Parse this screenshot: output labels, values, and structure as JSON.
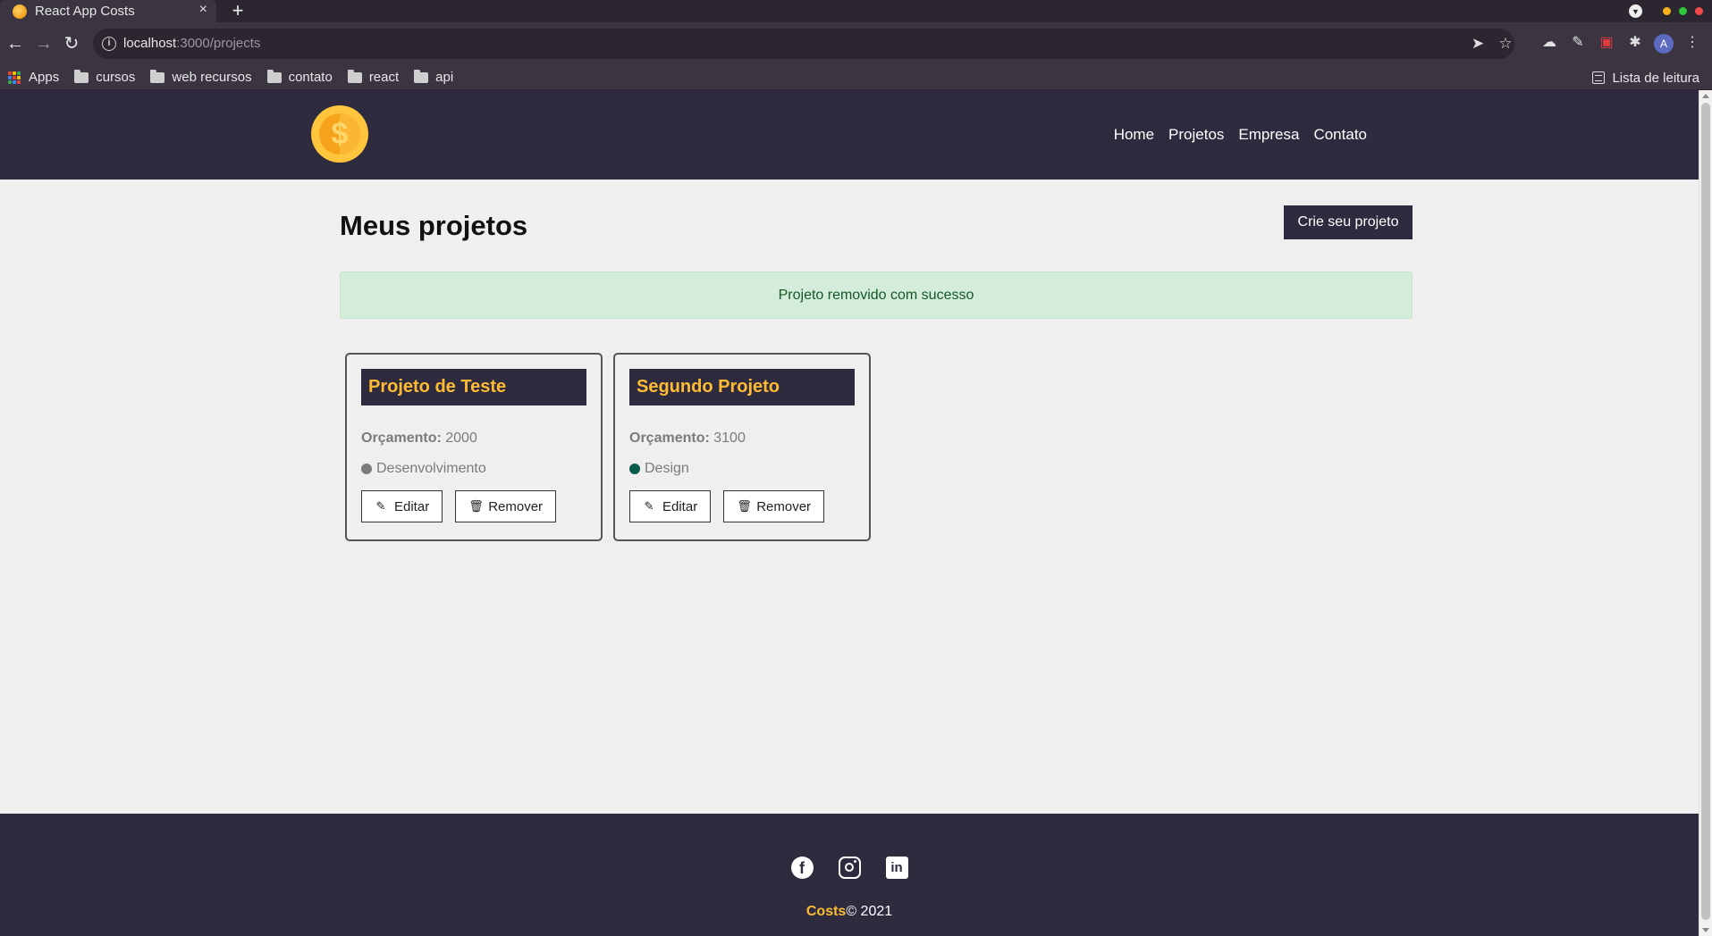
{
  "browser": {
    "tab_title": "React App Costs",
    "tab_close": "×",
    "new_tab": "+",
    "url_host": "localhost",
    "url_path": ":3000/projects",
    "bookmarks": [
      "Apps",
      "cursos",
      "web recursos",
      "contato",
      "react",
      "api"
    ],
    "reading_list": "Lista de leitura",
    "avatar_letter": "A"
  },
  "navbar": {
    "logo_symbol": "$",
    "links": [
      "Home",
      "Projetos",
      "Empresa",
      "Contato"
    ]
  },
  "main": {
    "title": "Meus projetos",
    "create_button": "Crie seu projeto",
    "alert": "Projeto removido com sucesso",
    "budget_label": "Orçamento:",
    "edit_label": "Editar",
    "remove_label": "Remover",
    "projects": [
      {
        "name": "Projeto de Teste",
        "budget": "2000",
        "category": "Desenvolvimento",
        "category_color": "#7b7b7b"
      },
      {
        "name": "Segundo Projeto",
        "budget": "3100",
        "category": "Design",
        "category_color": "#0b5d4b"
      }
    ]
  },
  "footer": {
    "icons": [
      "facebook-icon",
      "instagram-icon",
      "linkedin-icon"
    ],
    "brand": "Costs",
    "copyright": "© 2021"
  },
  "colors": {
    "primary_dark": "#2e2b3f",
    "accent": "#ffbb33",
    "success_bg": "#d4edda",
    "success_text": "#155724"
  }
}
